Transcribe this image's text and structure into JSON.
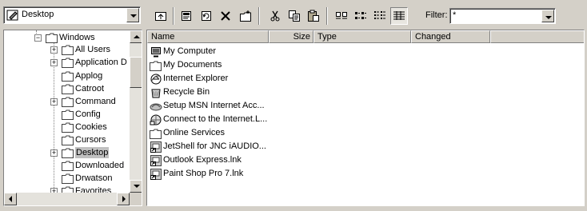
{
  "toolbar": {
    "location": "Desktop",
    "filter_label": "Filter:",
    "filter_value": "*",
    "buttons": [
      "up-one-level",
      "properties",
      "refresh",
      "delete",
      "new-folder",
      "cut",
      "copy",
      "paste",
      "large-icons",
      "small-icons",
      "list",
      "details"
    ]
  },
  "tree": {
    "items": [
      {
        "label": "Windows",
        "expander": "−"
      },
      {
        "label": "All Users",
        "expander": "+"
      },
      {
        "label": "Application D",
        "expander": "+"
      },
      {
        "label": "Applog",
        "expander": ""
      },
      {
        "label": "Catroot",
        "expander": ""
      },
      {
        "label": "Command",
        "expander": "+"
      },
      {
        "label": "Config",
        "expander": ""
      },
      {
        "label": "Cookies",
        "expander": ""
      },
      {
        "label": "Cursors",
        "expander": ""
      },
      {
        "label": "Desktop",
        "expander": "+"
      },
      {
        "label": "Downloaded",
        "expander": ""
      },
      {
        "label": "Drwatson",
        "expander": ""
      },
      {
        "label": "Favorites",
        "expander": "+"
      }
    ]
  },
  "list": {
    "columns": [
      "Name",
      "Size",
      "Type",
      "Changed"
    ],
    "files": [
      {
        "name": "My Computer",
        "icon": "computer-icon"
      },
      {
        "name": "My Documents",
        "icon": "folder-icon"
      },
      {
        "name": "Internet Explorer",
        "icon": "ie-icon"
      },
      {
        "name": "Recycle Bin",
        "icon": "recycle-bin-icon"
      },
      {
        "name": "Setup MSN Internet Acc...",
        "icon": "msn-icon"
      },
      {
        "name": "Connect to the Internet.L...",
        "icon": "connect-icon"
      },
      {
        "name": "Online Services",
        "icon": "folder-icon"
      },
      {
        "name": "JetShell for JNC iAUDIO...",
        "icon": "shortcut-icon"
      },
      {
        "name": "Outlook Express.lnk",
        "icon": "shortcut-icon"
      },
      {
        "name": "Paint Shop Pro 7.lnk",
        "icon": "shortcut-icon"
      }
    ]
  }
}
